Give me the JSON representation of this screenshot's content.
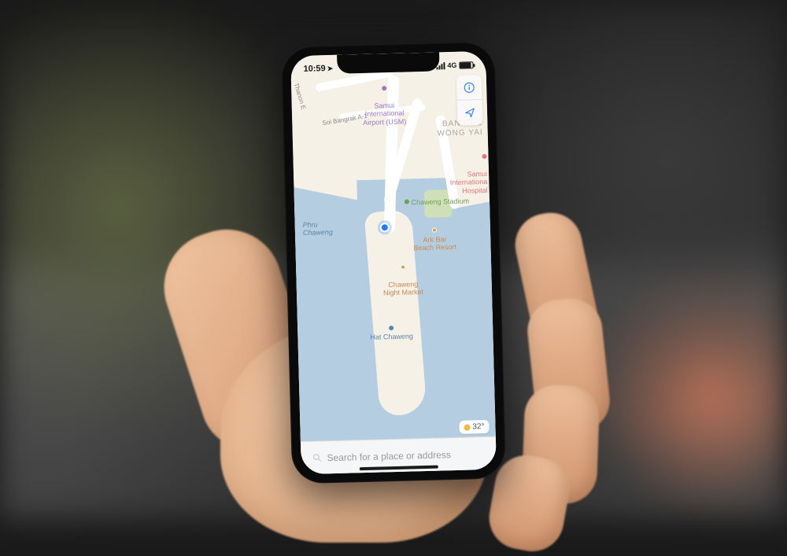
{
  "status": {
    "time": "10:59",
    "network": "4G"
  },
  "controls": {
    "info_icon": "info-icon",
    "locate_icon": "location-arrow-icon"
  },
  "map": {
    "roads": {
      "thanon_e": "Thanon E",
      "soi_bangrak": "Soi Bangrak A-1"
    },
    "airport": "Samui\nInternational\nAirport (USM)",
    "district": "BAN CHE\nWONG YAI",
    "hospital": "Samui\nInternationa\nHospital",
    "stadium": "Chaweng Stadium",
    "lagoon": "Phru\nChaweng",
    "resort": "Ark Bar\nBeach Resort",
    "market": "Chaweng\nNight Market",
    "bus": "Hat Chaweng"
  },
  "weather": {
    "temp": "32°"
  },
  "search": {
    "placeholder": "Search for a place or address"
  }
}
